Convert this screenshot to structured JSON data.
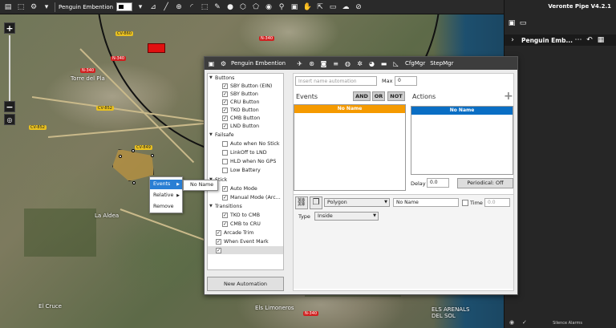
{
  "toolbar": {
    "vehicle_label": "Penguin Embention",
    "colors": {
      "bar": "#2a2a2a"
    },
    "icons": [
      "layers-icon",
      "mission-icon",
      "dropdown-icon",
      "ruler-icon",
      "line-icon",
      "target-icon",
      "arc-icon",
      "marquee-icon",
      "pin-icon",
      "circle-icon",
      "polygon-icon",
      "pentagon-icon",
      "waypoint-icon",
      "balloon-icon",
      "marker-icon",
      "hand-icon",
      "export-icon",
      "folder-icon",
      "cloud-icon",
      "measure-icon"
    ]
  },
  "app": {
    "title": "Veronte Pipe V4.2.1"
  },
  "right_pane": {
    "vehicle_name": "Penguin Emb...",
    "silence": "Silence Alarms"
  },
  "map": {
    "labels": {
      "town": "Torre del Pla",
      "south_town": "Els Limoneros",
      "right_town": "ELS ARENALS\nDEL SOL",
      "left_town": "El Cruce",
      "mid": "La Aldea"
    },
    "signs": {
      "cv": "CV-860",
      "n": "N-340",
      "n2": "N-340",
      "cv2": "CV-852",
      "cv3": "CV-849",
      "cv4": "CV-852",
      "red1": "N-340",
      "red2": "N-340"
    }
  },
  "dialog": {
    "title": "Penguin Embention",
    "menu": [
      "CfgMgr",
      "StepMgr"
    ],
    "tree": {
      "groups": [
        {
          "label": "Buttons",
          "items": [
            {
              "label": "SBY Button (EIN)",
              "checked": true
            },
            {
              "label": "SBY Button",
              "checked": true
            },
            {
              "label": "CRU Button",
              "checked": true
            },
            {
              "label": "TKO Button",
              "checked": true
            },
            {
              "label": "CMB Button",
              "checked": true
            },
            {
              "label": "LND Button",
              "checked": true
            }
          ]
        },
        {
          "label": "Failsafe",
          "items": [
            {
              "label": "Auto when No Stick",
              "checked": false
            },
            {
              "label": "LinkOff to LND",
              "checked": false
            },
            {
              "label": "HLD when No GPS",
              "checked": false
            },
            {
              "label": "Low Battery",
              "checked": false
            }
          ]
        },
        {
          "label": "Stick",
          "items": [
            {
              "label": "Auto Mode",
              "checked": true
            },
            {
              "label": "Manual Mode (Arc...",
              "checked": true
            }
          ]
        },
        {
          "label": "Transitions",
          "items": [
            {
              "label": "TKO to CMB",
              "checked": true
            },
            {
              "label": "CMB to CRU",
              "checked": true
            }
          ]
        }
      ],
      "root_items": [
        {
          "label": "Arcade Trim",
          "checked": true
        },
        {
          "label": "When Event Mark",
          "checked": true
        },
        {
          "label": "",
          "checked": true
        }
      ]
    },
    "new_automation": "New Automation",
    "name_placeholder": "Insert name automation",
    "max_label": "Max",
    "max_value": "0",
    "events_label": "Events",
    "logic": [
      "AND",
      "OR",
      "NOT"
    ],
    "events_list": [
      {
        "label": "No Name",
        "color": "#f59a00"
      }
    ],
    "actions_label": "Actions",
    "actions_list": [
      {
        "label": "No Name",
        "color": "#0a6ec4"
      }
    ],
    "delay_label": "Delay",
    "delay_value": "0.0",
    "periodical": "Periodical: Off",
    "condition": {
      "type": "Polygon",
      "name": "No Name",
      "time_label": "Time",
      "time_value": "0.0",
      "type_label": "Type",
      "type_value": "Inside"
    }
  },
  "context_menu": {
    "items": [
      "Events",
      "Relative",
      "Remove"
    ],
    "submenu": "No Name"
  }
}
